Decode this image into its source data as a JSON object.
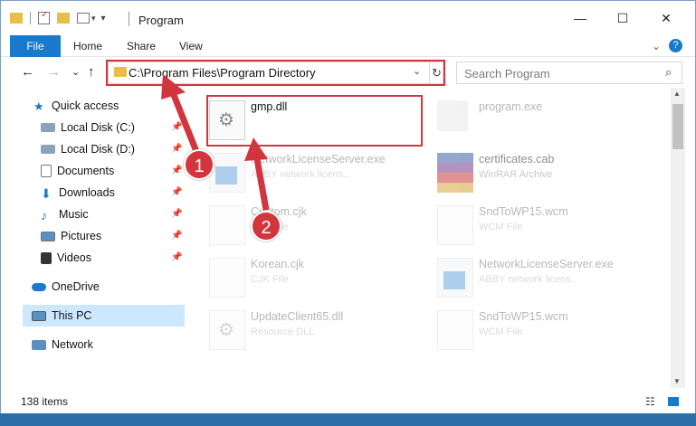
{
  "window": {
    "title": "Program",
    "minimize_glyph": "—",
    "maximize_glyph": "☐",
    "close_glyph": "✕"
  },
  "ribbon": {
    "tabs": [
      "File",
      "Home",
      "Share",
      "View"
    ],
    "expand_glyph": "⌄",
    "help_glyph": "?"
  },
  "nav": {
    "back_glyph": "←",
    "forward_glyph": "→",
    "recent_glyph": "⌄",
    "up_glyph": "↑",
    "address": "C:\\Program Files\\Program Directory",
    "search_placeholder": "Search Program"
  },
  "sidebar": {
    "quick_access": "Quick access",
    "items": [
      {
        "label": "Local Disk (C:)",
        "icon": "drive-icon",
        "pinned": true
      },
      {
        "label": "Local Disk (D:)",
        "icon": "drive-icon",
        "pinned": true
      },
      {
        "label": "Documents",
        "icon": "documents-icon",
        "pinned": true
      },
      {
        "label": "Downloads",
        "icon": "downloads-icon",
        "pinned": true
      },
      {
        "label": "Music",
        "icon": "music-icon",
        "pinned": true
      },
      {
        "label": "Pictures",
        "icon": "pictures-icon",
        "pinned": true
      },
      {
        "label": "Videos",
        "icon": "videos-icon",
        "pinned": true
      }
    ],
    "onedrive": "OneDrive",
    "this_pc": "This PC",
    "network": "Network"
  },
  "files": [
    {
      "name": "gmp.dll",
      "sub": "",
      "icon": "gear-file-icon",
      "highlighted": true
    },
    {
      "name": "program.exe",
      "sub": "",
      "icon": "exe-icon",
      "highlighted": false
    },
    {
      "name": "NetworkLicenseServer.exe",
      "sub": "ABBY network licens...",
      "icon": "exe-icon",
      "highlighted": false
    },
    {
      "name": "certificates.cab",
      "sub": "WinRAR Archive",
      "icon": "archive-icon",
      "highlighted": false
    },
    {
      "name": "Custom.cjk",
      "sub": "CJK File",
      "icon": "file-icon",
      "highlighted": false
    },
    {
      "name": "SndToWP15.wcm",
      "sub": "WCM File",
      "icon": "file-icon",
      "highlighted": false
    },
    {
      "name": "Korean.cjk",
      "sub": "CJK File",
      "icon": "file-icon",
      "highlighted": false
    },
    {
      "name": "NetworkLicenseServer.exe",
      "sub": "ABBY network licens...",
      "icon": "exe-icon",
      "highlighted": false
    },
    {
      "name": "UpdateClient65.dll",
      "sub": "Resource DLL",
      "icon": "gear-file-icon",
      "highlighted": false
    },
    {
      "name": "SndToWP15.wcm",
      "sub": "WCM File",
      "icon": "file-icon",
      "highlighted": false
    }
  ],
  "status": {
    "count": "138 items"
  },
  "annotations": {
    "step1": "1",
    "step2": "2",
    "color": "#d2353d"
  }
}
